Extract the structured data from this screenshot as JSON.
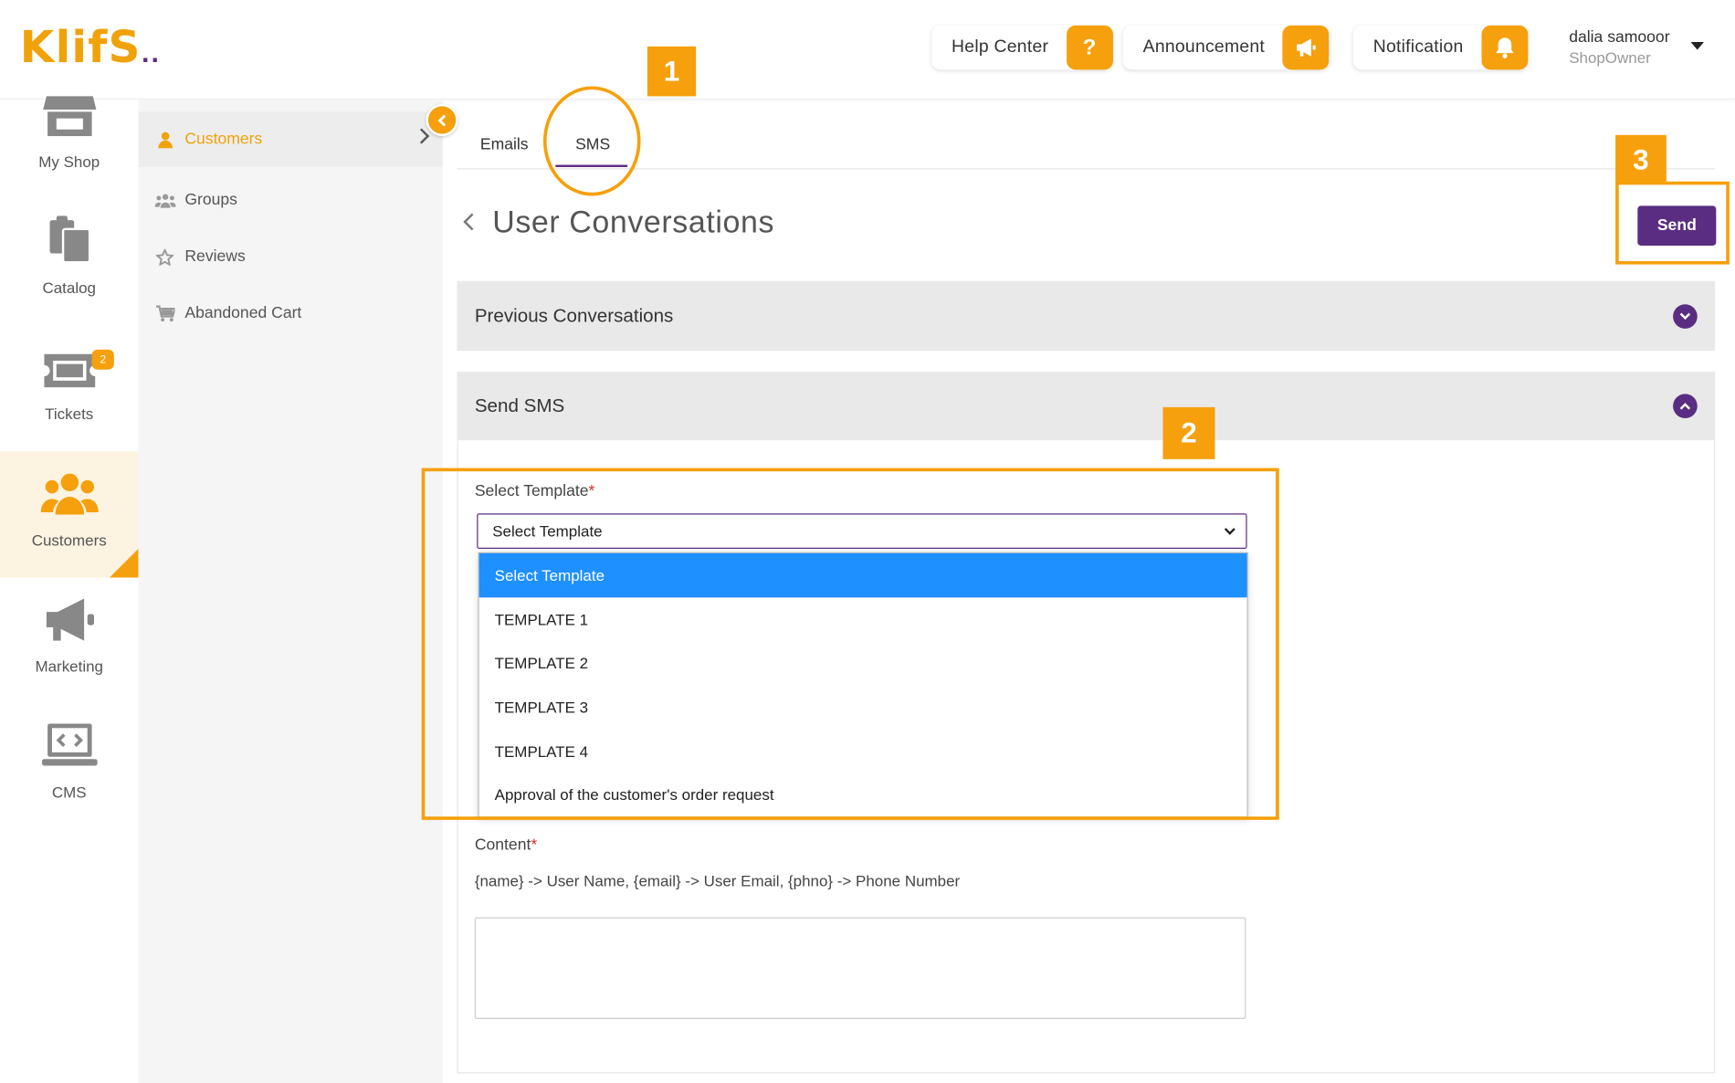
{
  "logo": {
    "text": "KlifS",
    "dots": ".."
  },
  "header": {
    "help_label": "Help Center",
    "help_icon": "?",
    "announcement_label": "Announcement",
    "notification_label": "Notification",
    "user_name": "dalia samooor",
    "user_role": "ShopOwner"
  },
  "rail": {
    "items": [
      {
        "label": "My Shop",
        "icon": "store-icon"
      },
      {
        "label": "Catalog",
        "icon": "catalog-icon"
      },
      {
        "label": "Tickets",
        "icon": "ticket-icon",
        "badge": "2"
      },
      {
        "label": "Customers",
        "icon": "customers-icon",
        "active": true
      },
      {
        "label": "Marketing",
        "icon": "megaphone-icon"
      },
      {
        "label": "CMS",
        "icon": "cms-icon"
      }
    ]
  },
  "submenu": {
    "items": [
      {
        "label": "Customers",
        "active": true
      },
      {
        "label": "Groups"
      },
      {
        "label": "Reviews"
      },
      {
        "label": "Abandoned Cart"
      }
    ]
  },
  "tabs": [
    {
      "label": "Emails"
    },
    {
      "label": "SMS",
      "active": true
    }
  ],
  "page": {
    "title": "User Conversations",
    "send_label": "Send"
  },
  "panels": {
    "previous": "Previous Conversations",
    "send_sms": "Send SMS"
  },
  "form": {
    "template_label": "Select Template",
    "required_mark": "*",
    "template_selected": "Select Template",
    "template_options": [
      "Select Template",
      "TEMPLATE 1",
      "TEMPLATE 2",
      "TEMPLATE 3",
      "TEMPLATE 4",
      "Approval of the customer's order request"
    ],
    "content_label": "Content",
    "content_hint": "{name} -> User Name, {email} -> User Email, {phno} -> Phone Number",
    "content_value": ""
  },
  "annotations": {
    "step1": "1",
    "step2": "2",
    "step3": "3"
  },
  "colors": {
    "accent": "#f5a00c",
    "brand": "#5a2d82",
    "highlight": "#1e90ff"
  }
}
